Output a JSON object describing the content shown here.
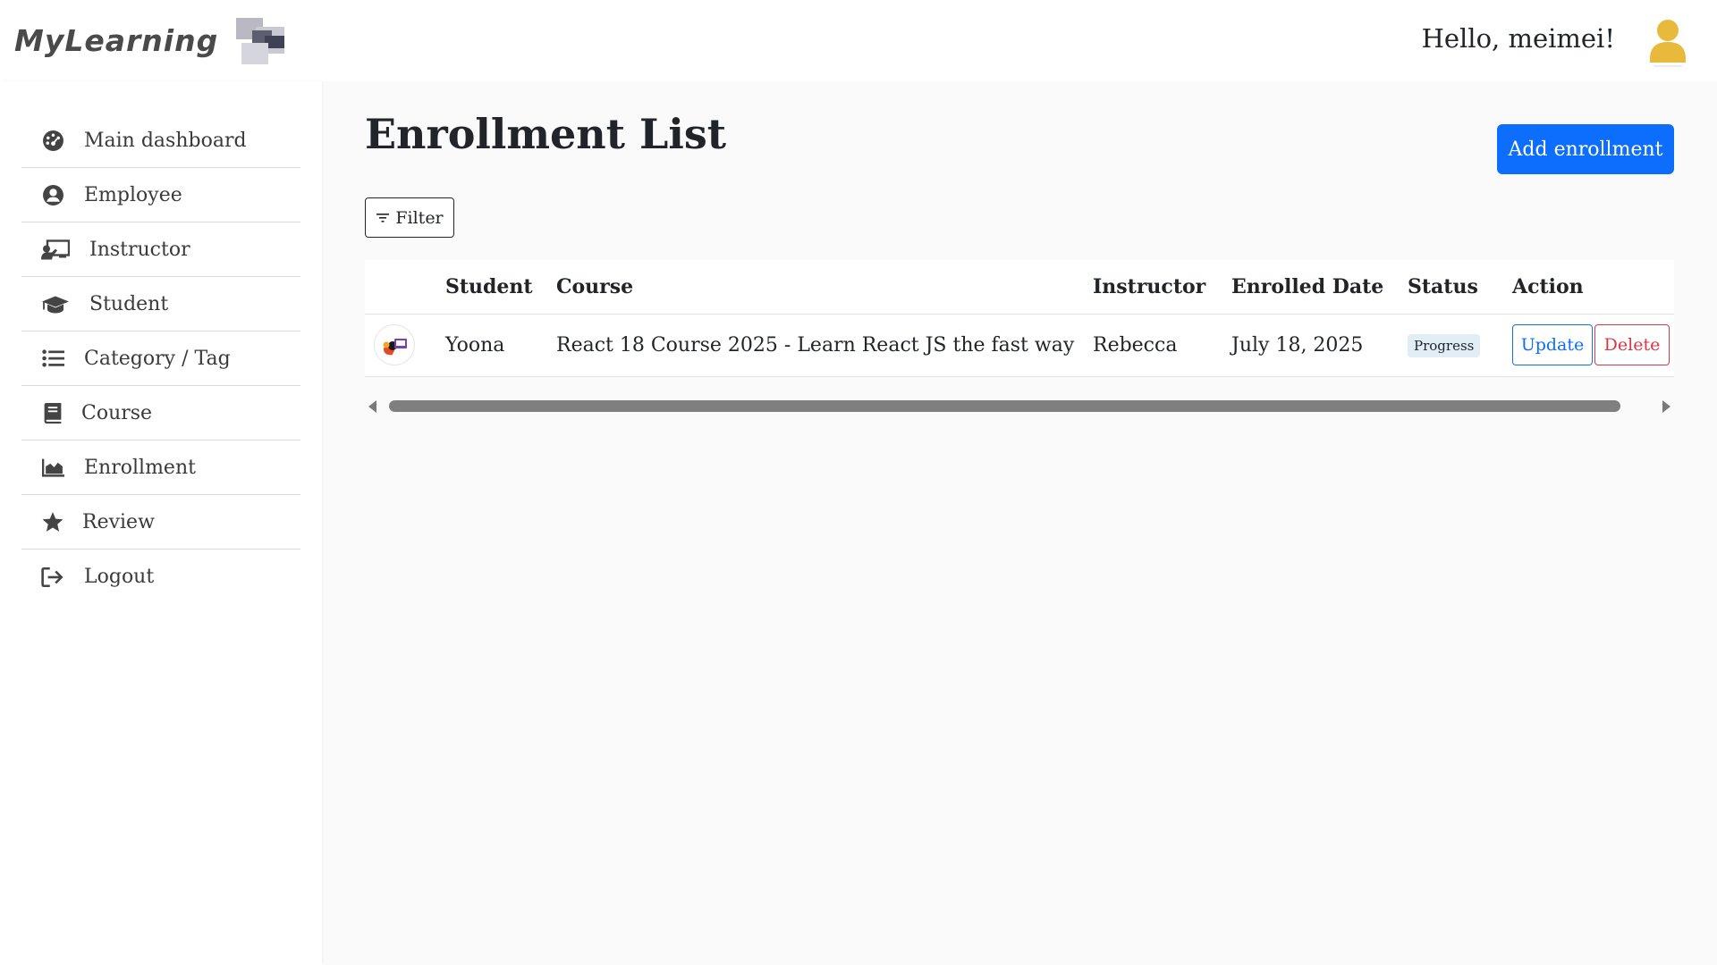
{
  "header": {
    "logo_text": "MyLearning",
    "greeting": "Hello, meimei!"
  },
  "sidebar": {
    "items": [
      {
        "label": "Main dashboard",
        "icon": "dashboard-icon"
      },
      {
        "label": "Employee",
        "icon": "user-circle-icon"
      },
      {
        "label": "Instructor",
        "icon": "chalkboard-teacher-icon"
      },
      {
        "label": "Student",
        "icon": "graduation-cap-icon"
      },
      {
        "label": "Category / Tag",
        "icon": "list-icon"
      },
      {
        "label": "Course",
        "icon": "book-icon"
      },
      {
        "label": "Enrollment",
        "icon": "area-chart-icon"
      },
      {
        "label": "Review",
        "icon": "star-icon"
      },
      {
        "label": "Logout",
        "icon": "logout-icon"
      }
    ]
  },
  "main": {
    "title": "Enrollment List",
    "add_button": "Add enrollment",
    "filter_button": "Filter",
    "table": {
      "headers": [
        "",
        "Student",
        "Course",
        "Instructor",
        "Enrolled Date",
        "Status",
        "Action"
      ],
      "rows": [
        {
          "student": "Yoona",
          "course": "React 18 Course 2025 - Learn React JS the fast way",
          "instructor": "Rebecca",
          "enrolled_date": "July 18, 2025",
          "status": "Progress",
          "update_label": "Update",
          "delete_label": "Delete"
        }
      ]
    }
  },
  "colors": {
    "primary": "#0d6efd",
    "danger": "#dc3545",
    "avatar": "#e8b93a",
    "badge_bg": "#e2eef6"
  }
}
